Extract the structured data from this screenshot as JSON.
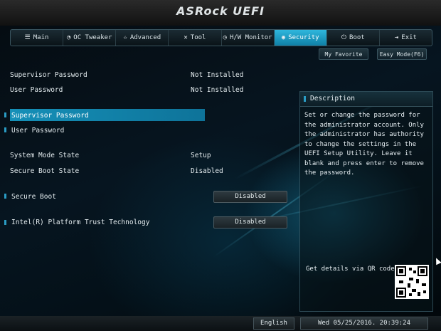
{
  "header": {
    "logo": "ASRock UEFI"
  },
  "tabs": [
    {
      "label": "Main",
      "icon": "list-icon",
      "glyph": "☰"
    },
    {
      "label": "OC Tweaker",
      "icon": "gauge-icon",
      "glyph": "◔"
    },
    {
      "label": "Advanced",
      "icon": "star-icon",
      "glyph": "☆"
    },
    {
      "label": "Tool",
      "icon": "wrench-icon",
      "glyph": "✕"
    },
    {
      "label": "H/W Monitor",
      "icon": "clock-icon",
      "glyph": "◷"
    },
    {
      "label": "Security",
      "icon": "shield-icon",
      "glyph": "◉"
    },
    {
      "label": "Boot",
      "icon": "power-icon",
      "glyph": "⏻"
    },
    {
      "label": "Exit",
      "icon": "exit-icon",
      "glyph": "⇥"
    }
  ],
  "active_tab": "Security",
  "buttons": {
    "favorite": "My Favorite",
    "easy_mode": "Easy Mode(F6)"
  },
  "status": {
    "supervisor_label": "Supervisor Password",
    "supervisor_value": "Not Installed",
    "user_label": "User Password",
    "user_value": "Not Installed",
    "system_mode_label": "System Mode State",
    "system_mode_value": "Setup",
    "secure_boot_state_label": "Secure Boot State",
    "secure_boot_state_value": "Disabled"
  },
  "menu": {
    "supervisor_password": "Supervisor Password",
    "user_password": "User Password",
    "secure_boot": "Secure Boot",
    "secure_boot_value": "Disabled",
    "ptt": "Intel(R) Platform Trust Technology",
    "ptt_value": "Disabled"
  },
  "description": {
    "title": "Description",
    "text": "Set or change the password for the administrator account. Only the administrator has authority to change the settings in the UEFI Setup Utility. Leave it blank and press enter to remove the password.",
    "qr_label": "Get details via QR code"
  },
  "footer": {
    "language": "English",
    "datetime": "Wed 05/25/2016. 20:39:24"
  },
  "colors": {
    "accent": "#1a9cc9",
    "highlight": "#1590b8"
  }
}
